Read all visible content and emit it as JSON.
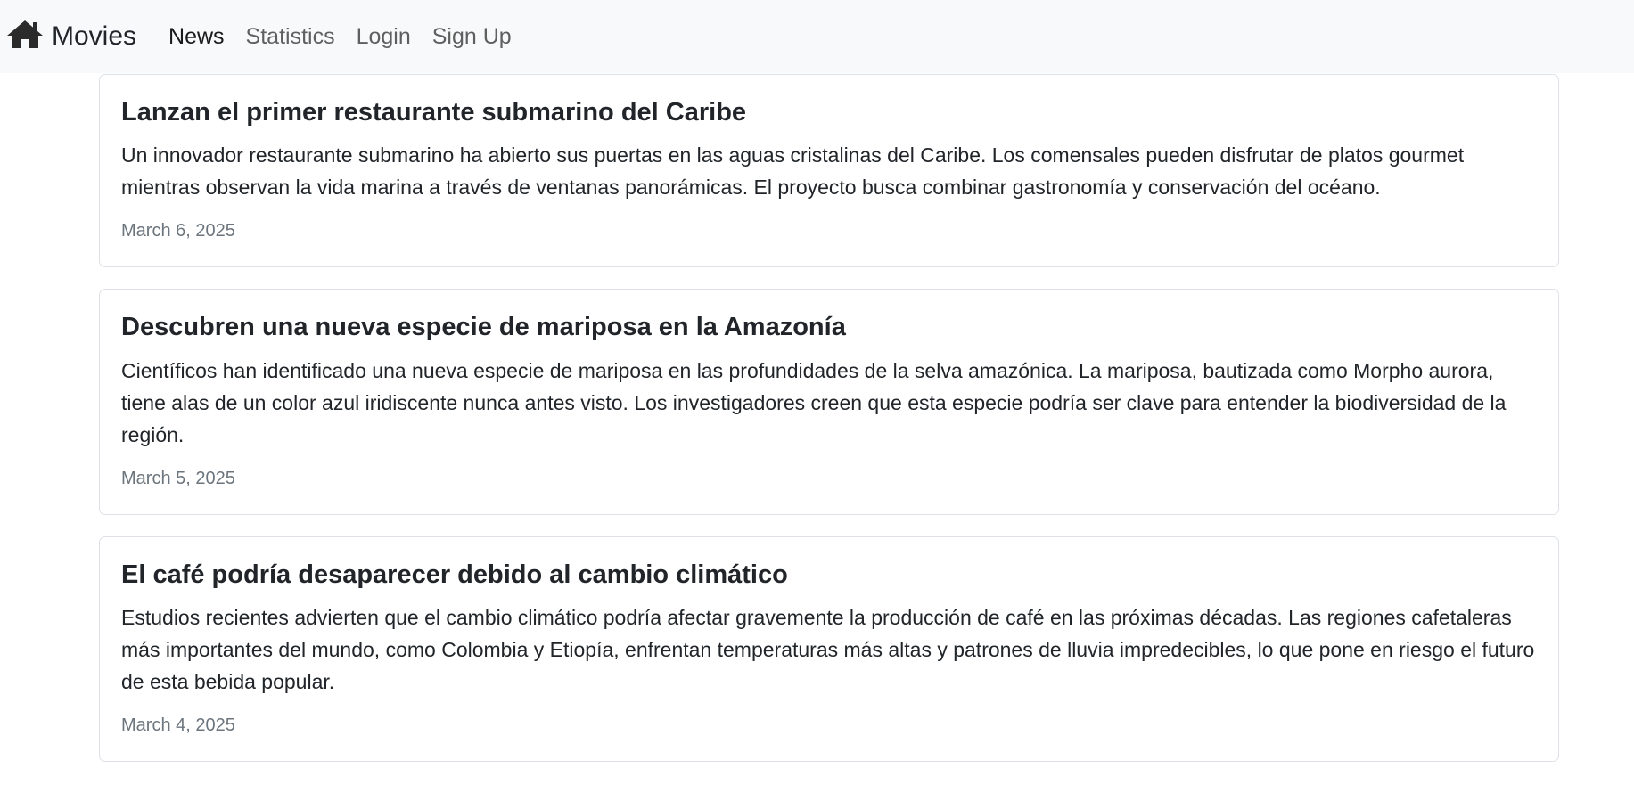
{
  "navbar": {
    "brand": {
      "icon": "home-icon",
      "label": "Movies"
    },
    "links": [
      {
        "label": "News",
        "active": true
      },
      {
        "label": "Statistics",
        "active": false
      },
      {
        "label": "Login",
        "active": false
      },
      {
        "label": "Sign Up",
        "active": false
      }
    ]
  },
  "news": [
    {
      "title": "Lanzan el primer restaurante submarino del Caribe",
      "body": "Un innovador restaurante submarino ha abierto sus puertas en las aguas cristalinas del Caribe. Los comensales pueden disfrutar de platos gourmet mientras observan la vida marina a través de ventanas panorámicas. El proyecto busca combinar gastronomía y conservación del océano.",
      "date": "March 6, 2025"
    },
    {
      "title": "Descubren una nueva especie de mariposa en la Amazonía",
      "body": "Científicos han identificado una nueva especie de mariposa en las profundidades de la selva amazónica. La mariposa, bautizada como Morpho aurora, tiene alas de un color azul iridiscente nunca antes visto. Los investigadores creen que esta especie podría ser clave para entender la biodiversidad de la región.",
      "date": "March 5, 2025"
    },
    {
      "title": "El café podría desaparecer debido al cambio climático",
      "body": "Estudios recientes advierten que el cambio climático podría afectar gravemente la producción de café en las próximas décadas. Las regiones cafetaleras más importantes del mundo, como Colombia y Etiopía, enfrentan temperaturas más altas y patrones de lluvia impredecibles, lo que pone en riesgo el futuro de esta bebida popular.",
      "date": "March 4, 2025"
    }
  ],
  "colors": {
    "navbar_bg": "#f8f9fa",
    "text": "#212529",
    "muted": "#6c757d",
    "border": "#dee2e6"
  }
}
